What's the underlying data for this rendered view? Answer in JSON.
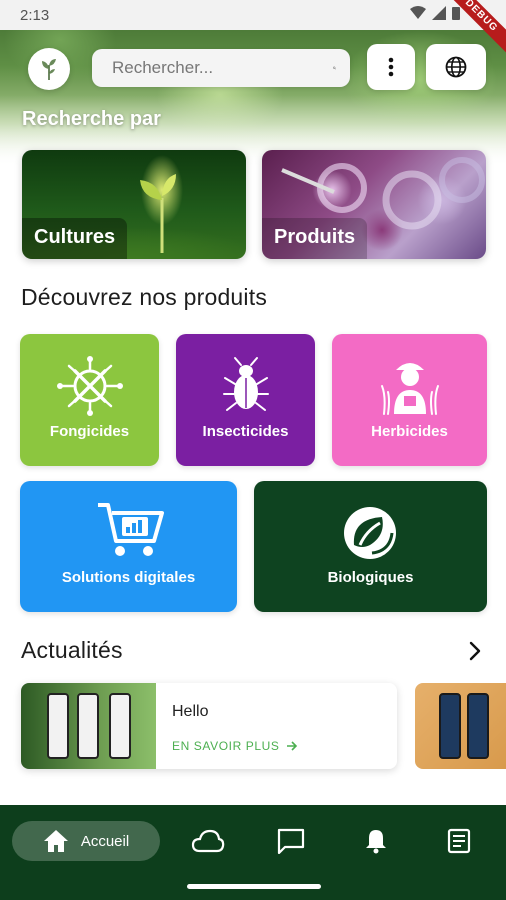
{
  "status_bar": {
    "time": "2:13",
    "debug_label": "DEBUG"
  },
  "search": {
    "placeholder": "Rechercher..."
  },
  "search_by": {
    "title": "Recherche par"
  },
  "categories": [
    {
      "label": "Cultures"
    },
    {
      "label": "Produits"
    }
  ],
  "products_section": {
    "title": "Découvrez nos produits",
    "tiles": [
      {
        "label": "Fongicides",
        "color": "#8cc63f"
      },
      {
        "label": "Insecticides",
        "color": "#7b1fa2"
      },
      {
        "label": "Herbicides",
        "color": "#f36bc5"
      },
      {
        "label": "Solutions digitales",
        "color": "#2196f3"
      },
      {
        "label": "Biologiques",
        "color": "#0e4320"
      }
    ]
  },
  "news": {
    "title": "Actualités",
    "items": [
      {
        "title": "Hello",
        "more_label": "EN SAVOIR PLUS"
      }
    ]
  },
  "bottom_nav": {
    "home_label": "Accueil",
    "items": [
      "home-icon",
      "cloud-icon",
      "chat-icon",
      "bell-icon",
      "document-icon"
    ],
    "background": "#0d3e1c"
  }
}
